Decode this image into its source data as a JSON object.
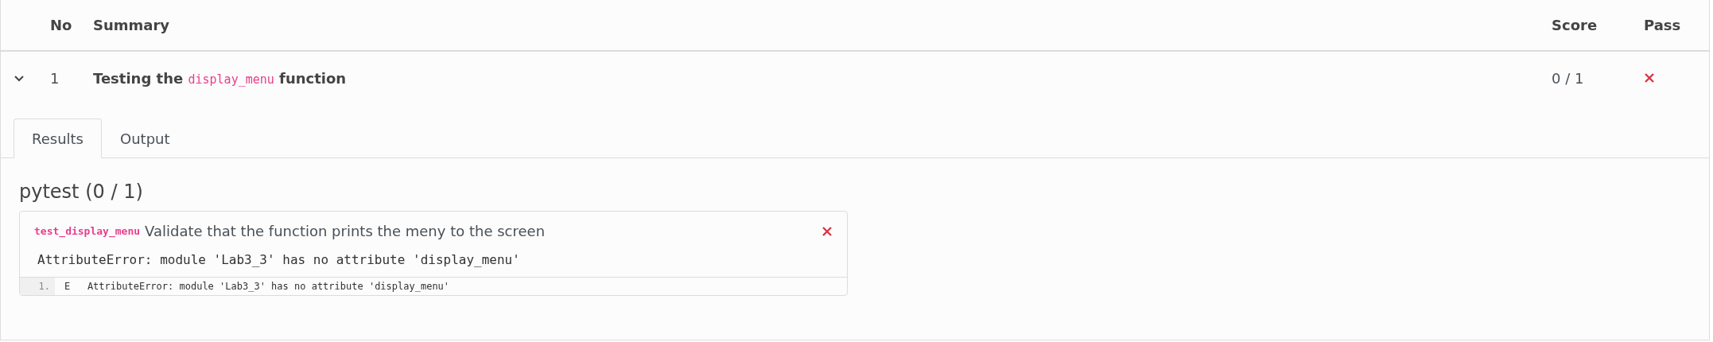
{
  "table": {
    "columns": [
      "No",
      "Summary",
      "Score",
      "Pass"
    ],
    "rows": [
      {
        "expanded": true,
        "no": "1",
        "summary": [
          {
            "kind": "text",
            "text": "Testing the "
          },
          {
            "kind": "code",
            "text": "display_menu"
          },
          {
            "kind": "text",
            "text": " function"
          }
        ],
        "score": "0 / 1",
        "passed": false,
        "tabs": [
          {
            "label": "Results",
            "selected": true
          },
          {
            "label": "Output",
            "selected": false
          }
        ],
        "suite": {
          "title": "pytest (0 / 1)",
          "tests": [
            {
              "name": "test_display_menu",
              "description": "Validate that the function prints the meny to the screen",
              "passed": false,
              "error": "AttributeError: module 'Lab3_3' has no attribute 'display_menu'",
              "trace": [
                {
                  "line_no": "1.",
                  "text": "E   AttributeError: module 'Lab3_3' has no attribute 'display_menu'"
                }
              ]
            }
          ]
        }
      }
    ]
  }
}
